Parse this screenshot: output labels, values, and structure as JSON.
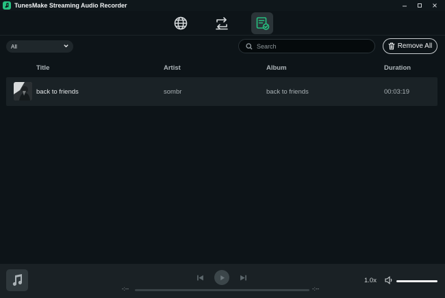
{
  "window": {
    "title": "TunesMake Streaming Audio Recorder",
    "controls": [
      "minimize",
      "maximize",
      "close"
    ]
  },
  "nav": {
    "items": [
      {
        "name": "web-player",
        "icon": "globe-icon",
        "active": false
      },
      {
        "name": "converting",
        "icon": "convert-icon",
        "active": false
      },
      {
        "name": "converted",
        "icon": "converted-list-icon",
        "active": true
      }
    ],
    "active_color": "#26c281"
  },
  "toolbar": {
    "filter_value": "All",
    "search_placeholder": "Search",
    "remove_all_label": "Remove All"
  },
  "table": {
    "columns": [
      "Title",
      "Artist",
      "Album",
      "Duration"
    ],
    "rows": [
      {
        "title": "back to friends",
        "artist": "sombr",
        "album": "back to friends",
        "duration": "00:03:19"
      }
    ]
  },
  "player": {
    "current_time": "-:--",
    "total_time": "-:--",
    "speed": "1.0x",
    "volume_fraction": 1.0
  }
}
